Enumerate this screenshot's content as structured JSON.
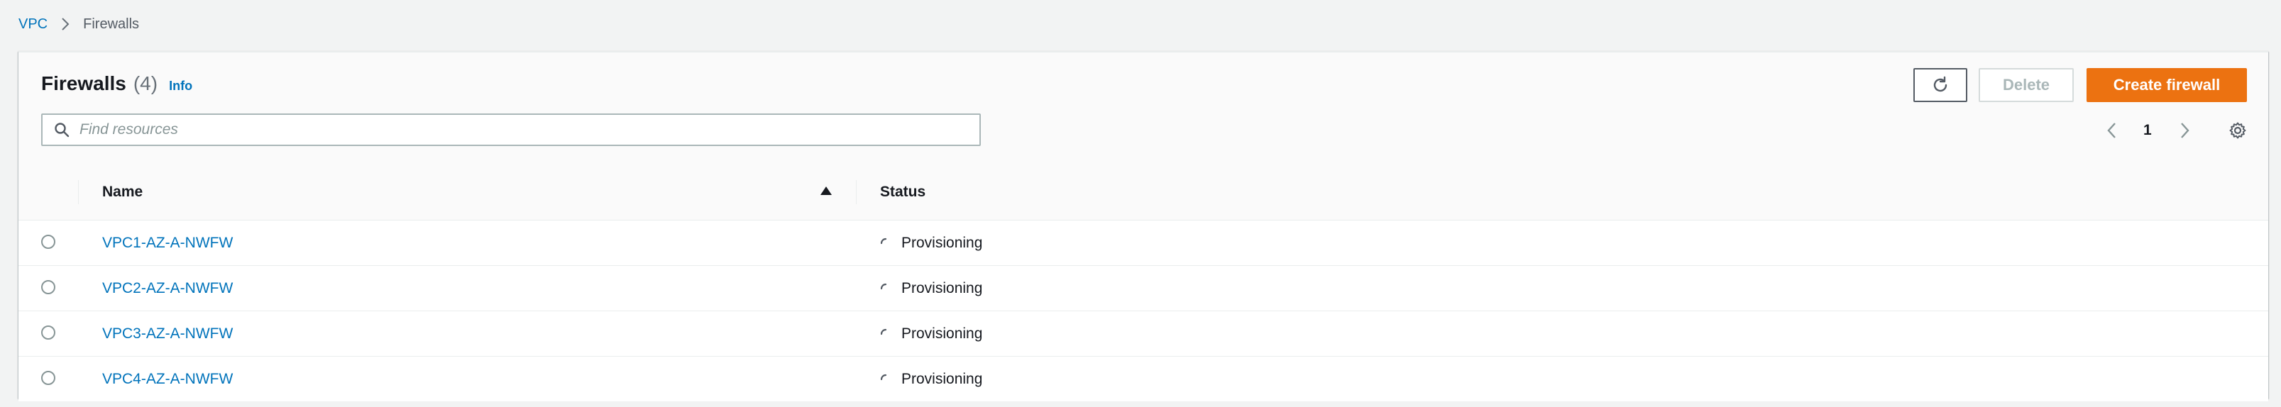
{
  "breadcrumb": {
    "root": "VPC",
    "current": "Firewalls"
  },
  "header": {
    "title": "Firewalls",
    "count": "(4)",
    "info": "Info"
  },
  "toolbar": {
    "refresh_icon": "refresh-icon",
    "delete_label": "Delete",
    "create_label": "Create firewall"
  },
  "search": {
    "placeholder": "Find resources",
    "value": ""
  },
  "pagination": {
    "current_page": "1"
  },
  "table": {
    "columns": {
      "name": "Name",
      "status": "Status"
    },
    "sort": "ascending",
    "rows": [
      {
        "name": "VPC1-AZ-A-NWFW",
        "status": "Provisioning"
      },
      {
        "name": "VPC2-AZ-A-NWFW",
        "status": "Provisioning"
      },
      {
        "name": "VPC3-AZ-A-NWFW",
        "status": "Provisioning"
      },
      {
        "name": "VPC4-AZ-A-NWFW",
        "status": "Provisioning"
      }
    ]
  },
  "colors": {
    "link": "#0073bb",
    "primary_button": "#ec7211",
    "disabled_text": "#aab7b8",
    "background": "#f2f3f3"
  }
}
